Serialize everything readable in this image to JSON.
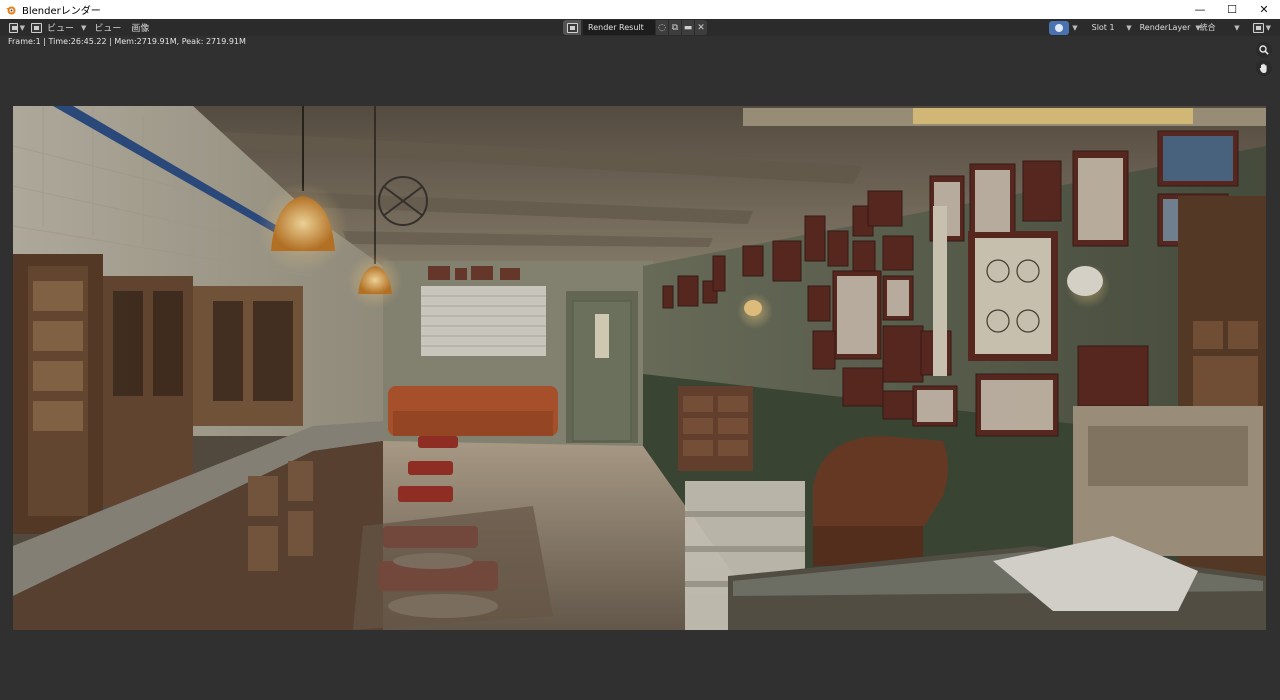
{
  "window": {
    "title": "Blenderレンダー",
    "buttons": {
      "minimize": "—",
      "maximize": "☐",
      "close": "✕"
    }
  },
  "header": {
    "menus": [
      "ビュー",
      "ビュー",
      "画像"
    ],
    "image_name": "Render Result",
    "slot": "Slot 1",
    "layer": "RenderLayer",
    "pass": "統合"
  },
  "status": {
    "text": "Frame:1 | Time:26:45.22 | Mem:2719.91M, Peak: 2719.91M"
  },
  "render": {
    "description_icon": "render-result-image",
    "room_colors": {
      "ceiling": "#7a6e5f",
      "wall_right": "#5e6550",
      "tiles": "#c9c4b6",
      "floor": "#8a7b6a",
      "sofa": "#b4572e",
      "chair": "#9a3128",
      "lamp": "#f2b04e"
    }
  }
}
